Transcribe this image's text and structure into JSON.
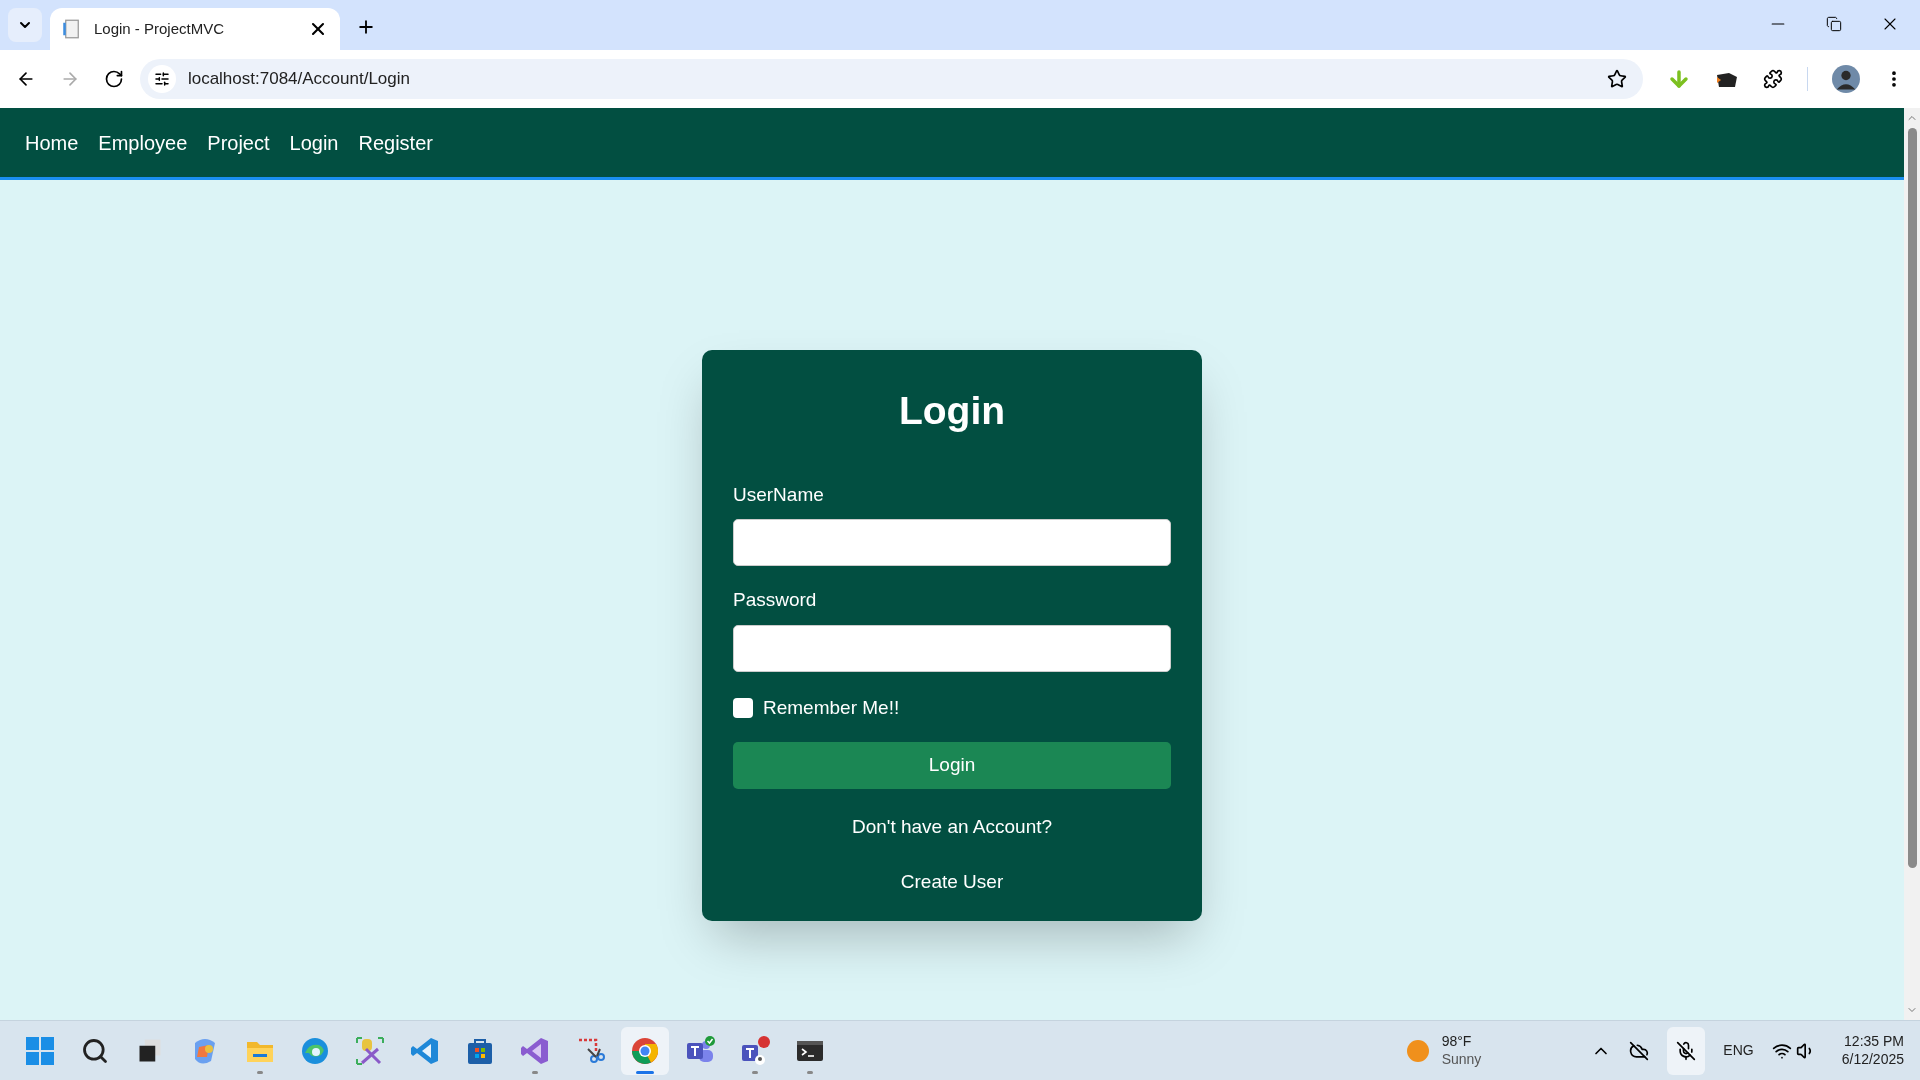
{
  "browser": {
    "tabs": [
      {
        "title": "Login - ProjectMVC",
        "selected": true
      }
    ],
    "address": "localhost:7084/Account/Login"
  },
  "navbar": {
    "links": [
      "Home",
      "Employee",
      "Project",
      "Login",
      "Register"
    ]
  },
  "login_card": {
    "title": "Login",
    "fields": [
      {
        "label": "UserName"
      },
      {
        "label": "Password"
      }
    ],
    "remember": {
      "label": "Remember Me!!",
      "checked": false
    },
    "submit": "Login",
    "prompt": "Don't have an Account?",
    "link": "Create User"
  },
  "taskbar": {
    "apps": [
      {
        "kind": "windows",
        "running": false,
        "selected": false
      },
      {
        "kind": "search",
        "running": false,
        "selected": false
      },
      {
        "kind": "taskview",
        "running": false,
        "selected": false
      },
      {
        "kind": "copilot",
        "running": false,
        "selected": false
      },
      {
        "kind": "folder",
        "running": true,
        "selected": false
      },
      {
        "kind": "edge",
        "running": false,
        "selected": false
      },
      {
        "kind": "tool",
        "running": false,
        "selected": false
      },
      {
        "kind": "vscode",
        "running": false,
        "selected": false
      },
      {
        "kind": "store",
        "running": false,
        "selected": false
      },
      {
        "kind": "vs",
        "running": true,
        "selected": false
      },
      {
        "kind": "snip",
        "running": false,
        "selected": false
      },
      {
        "kind": "chrome",
        "running": true,
        "selected": true
      },
      {
        "kind": "teams",
        "running": false,
        "selected": false
      },
      {
        "kind": "teams2",
        "running": true,
        "selected": false
      },
      {
        "kind": "terminal",
        "running": true,
        "selected": false
      }
    ],
    "weather": {
      "temperature": "98°F",
      "condition": "Sunny"
    },
    "language": "ENG",
    "time": "12:35 PM",
    "date": "6/12/2025"
  }
}
